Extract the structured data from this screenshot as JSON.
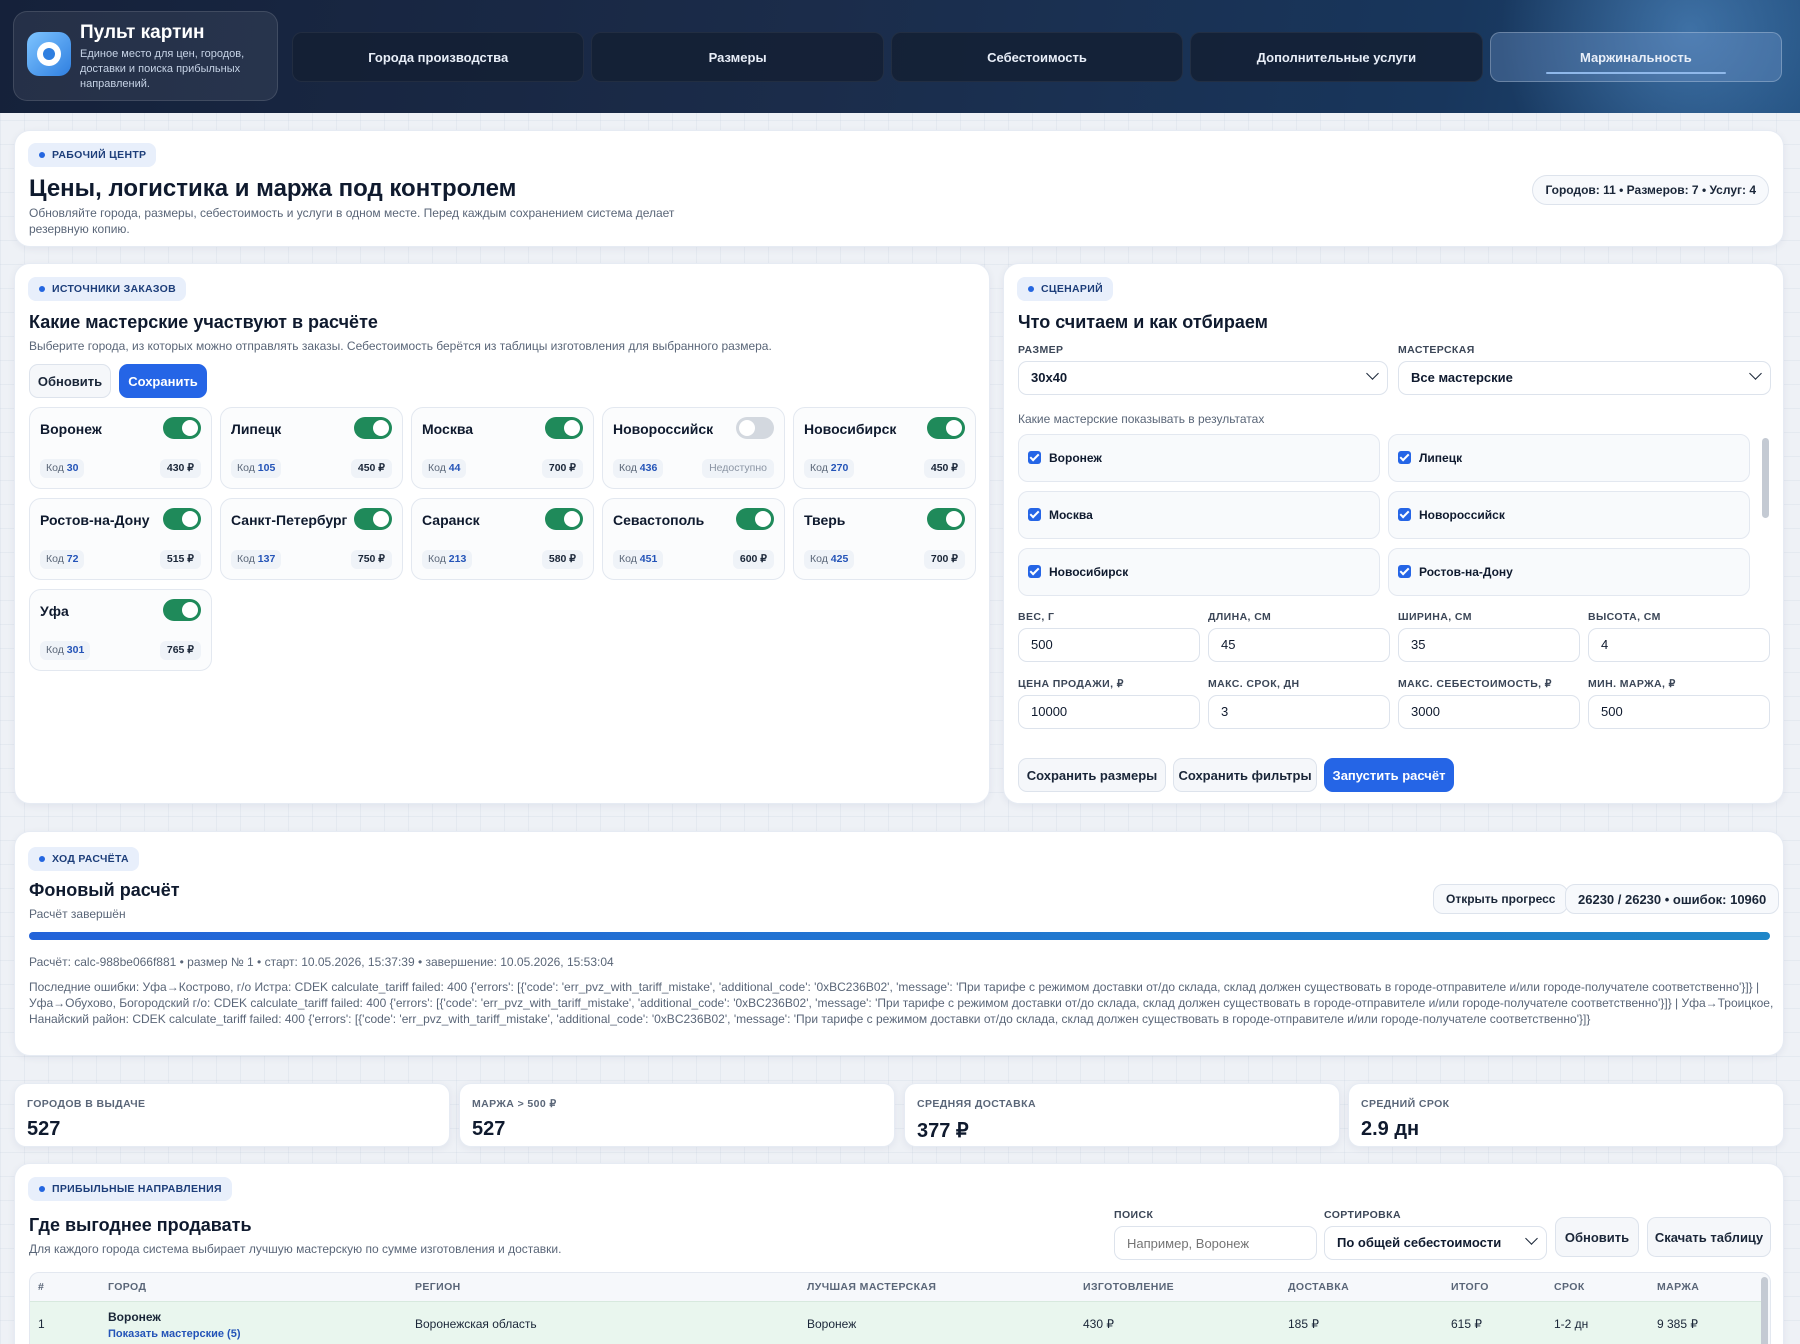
{
  "header": {
    "title": "Пульт картин",
    "subtitle": "Единое место для цен, городов, доставки и поиска прибыльных направлений.",
    "tabs": [
      "Города производства",
      "Размеры",
      "Себестоимость",
      "Дополнительные услуги",
      "Маржинальность"
    ],
    "active_tab": 4
  },
  "hero": {
    "pill": "РАБОЧИЙ ЦЕНТР",
    "title": "Цены, логистика и маржа под контролем",
    "description": "Обновляйте города, размеры, себестоимость и услуги в одном месте. Перед каждым сохранением система делает резервную копию.",
    "summary": "Городов: 11 • Размеров: 7 • Услуг: 4"
  },
  "sources": {
    "pill": "ИСТОЧНИКИ ЗАКАЗОВ",
    "title": "Какие мастерские участвуют в расчёте",
    "description": "Выберите города, из которых можно отправлять заказы. Себестоимость берётся из таблицы изготовления для выбранного размера.",
    "refresh_label": "Обновить",
    "save_label": "Сохранить",
    "code_prefix": "Код",
    "cities": [
      {
        "name": "Воронеж",
        "code": "30",
        "price": "430 ₽",
        "enabled": true
      },
      {
        "name": "Липецк",
        "code": "105",
        "price": "450 ₽",
        "enabled": true
      },
      {
        "name": "Москва",
        "code": "44",
        "price": "700 ₽",
        "enabled": true
      },
      {
        "name": "Новороссийск",
        "code": "436",
        "price": "Недоступно",
        "enabled": false
      },
      {
        "name": "Новосибирск",
        "code": "270",
        "price": "450 ₽",
        "enabled": true
      },
      {
        "name": "Ростов-на-Дону",
        "code": "72",
        "price": "515 ₽",
        "enabled": true
      },
      {
        "name": "Санкт-Петербург",
        "code": "137",
        "price": "750 ₽",
        "enabled": true
      },
      {
        "name": "Саранск",
        "code": "213",
        "price": "580 ₽",
        "enabled": true
      },
      {
        "name": "Севастополь",
        "code": "451",
        "price": "600 ₽",
        "enabled": true
      },
      {
        "name": "Тверь",
        "code": "425",
        "price": "700 ₽",
        "enabled": true
      },
      {
        "name": "Уфа",
        "code": "301",
        "price": "765 ₽",
        "enabled": true
      }
    ]
  },
  "scenario": {
    "pill": "СЦЕНАРИЙ",
    "title": "Что считаем и как отбираем",
    "size_label": "РАЗМЕР",
    "size_value": "30x40",
    "workshop_label": "МАСТЕРСКАЯ",
    "workshop_value": "Все мастерские",
    "show_label": "Какие мастерские показывать в результатах",
    "workshops": [
      "Воронеж",
      "Липецк",
      "Москва",
      "Новороссийск",
      "Новосибирск",
      "Ростов-на-Дону"
    ],
    "fields": [
      {
        "label": "ВЕС, Г",
        "value": "500"
      },
      {
        "label": "ДЛИНА, СМ",
        "value": "45"
      },
      {
        "label": "ШИРИНА, СМ",
        "value": "35"
      },
      {
        "label": "ВЫСОТА, СМ",
        "value": "4"
      },
      {
        "label": "ЦЕНА ПРОДАЖИ, ₽",
        "value": "10000"
      },
      {
        "label": "МАКС. СРОК, ДН",
        "value": "3"
      },
      {
        "label": "МАКС. СЕБЕСТОИМОСТЬ, ₽",
        "value": "3000"
      },
      {
        "label": "МИН. МАРЖА, ₽",
        "value": "500"
      }
    ],
    "save_sizes_label": "Сохранить размеры",
    "save_filters_label": "Сохранить фильтры",
    "run_label": "Запустить расчёт"
  },
  "progress": {
    "pill": "ХОД РАСЧЁТА",
    "title": "Фоновый расчёт",
    "status": "Расчёт завершён",
    "open_label": "Открыть прогресс",
    "counter": "26230 / 26230 • ошибок: 10960",
    "fraction": 1.0,
    "meta": "Расчёт: calc-988be066f881 • размер № 1 • старт: 10.05.2026, 15:37:39 • завершение: 10.05.2026, 15:53:04",
    "errors": "Последние ошибки: Уфа→Кострово, г/о Истра: CDEK calculate_tariff failed: 400 {'errors': [{'code': 'err_pvz_with_tariff_mistake', 'additional_code': '0xBC236B02', 'message': 'При тарифе с режимом доставки от/до склада, склад должен существовать в городе-отправителе и/или городе-получателе соответственно'}]} | Уфа→Обухово, Богородский г/о: CDEK calculate_tariff failed: 400 {'errors': [{'code': 'err_pvz_with_tariff_mistake', 'additional_code': '0xBC236B02', 'message': 'При тарифе с режимом доставки от/до склада, склад должен существовать в городе-отправителе и/или городе-получателе соответственно'}]} | Уфа→Троицкое, Нанайский район: CDEK calculate_tariff failed: 400 {'errors': [{'code': 'err_pvz_with_tariff_mistake', 'additional_code': '0xBC236B02', 'message': 'При тарифе с режимом доставки от/до склада, склад должен существовать в городе-отправителе и/или городе-получателе соответственно'}]}"
  },
  "stats": [
    {
      "label": "ГОРОДОВ В ВЫДАЧЕ",
      "value": "527"
    },
    {
      "label": "МАРЖА > 500 ₽",
      "value": "527"
    },
    {
      "label": "СРЕДНЯЯ ДОСТАВКА",
      "value": "377 ₽"
    },
    {
      "label": "СРЕДНИЙ СРОК",
      "value": "2.9 дн"
    }
  ],
  "profitable": {
    "pill": "ПРИБЫЛЬНЫЕ НАПРАВЛЕНИЯ",
    "title": "Где выгоднее продавать",
    "description": "Для каждого города система выбирает лучшую мастерскую по сумме изготовления и доставки.",
    "search_label": "ПОИСК",
    "search_placeholder": "Например, Воронеж",
    "sort_label": "СОРТИРОВКА",
    "sort_value": "По общей себестоимости",
    "refresh_label": "Обновить",
    "download_label": "Скачать таблицу",
    "columns": [
      "#",
      "ГОРОД",
      "РЕГИОН",
      "ЛУЧШАЯ МАСТЕРСКАЯ",
      "ИЗГОТОВЛЕНИЕ",
      "ДОСТАВКА",
      "ИТОГО",
      "СРОК",
      "МАРЖА"
    ],
    "rows": [
      {
        "n": "1",
        "city": "Воронеж",
        "link": "Показать мастерские (5)",
        "region": "Воронежская область",
        "workshop": "Воронеж",
        "make": "430 ₽",
        "delivery": "185 ₽",
        "total": "615 ₽",
        "term": "1-2 дн",
        "margin": "9 385 ₽"
      }
    ]
  }
}
